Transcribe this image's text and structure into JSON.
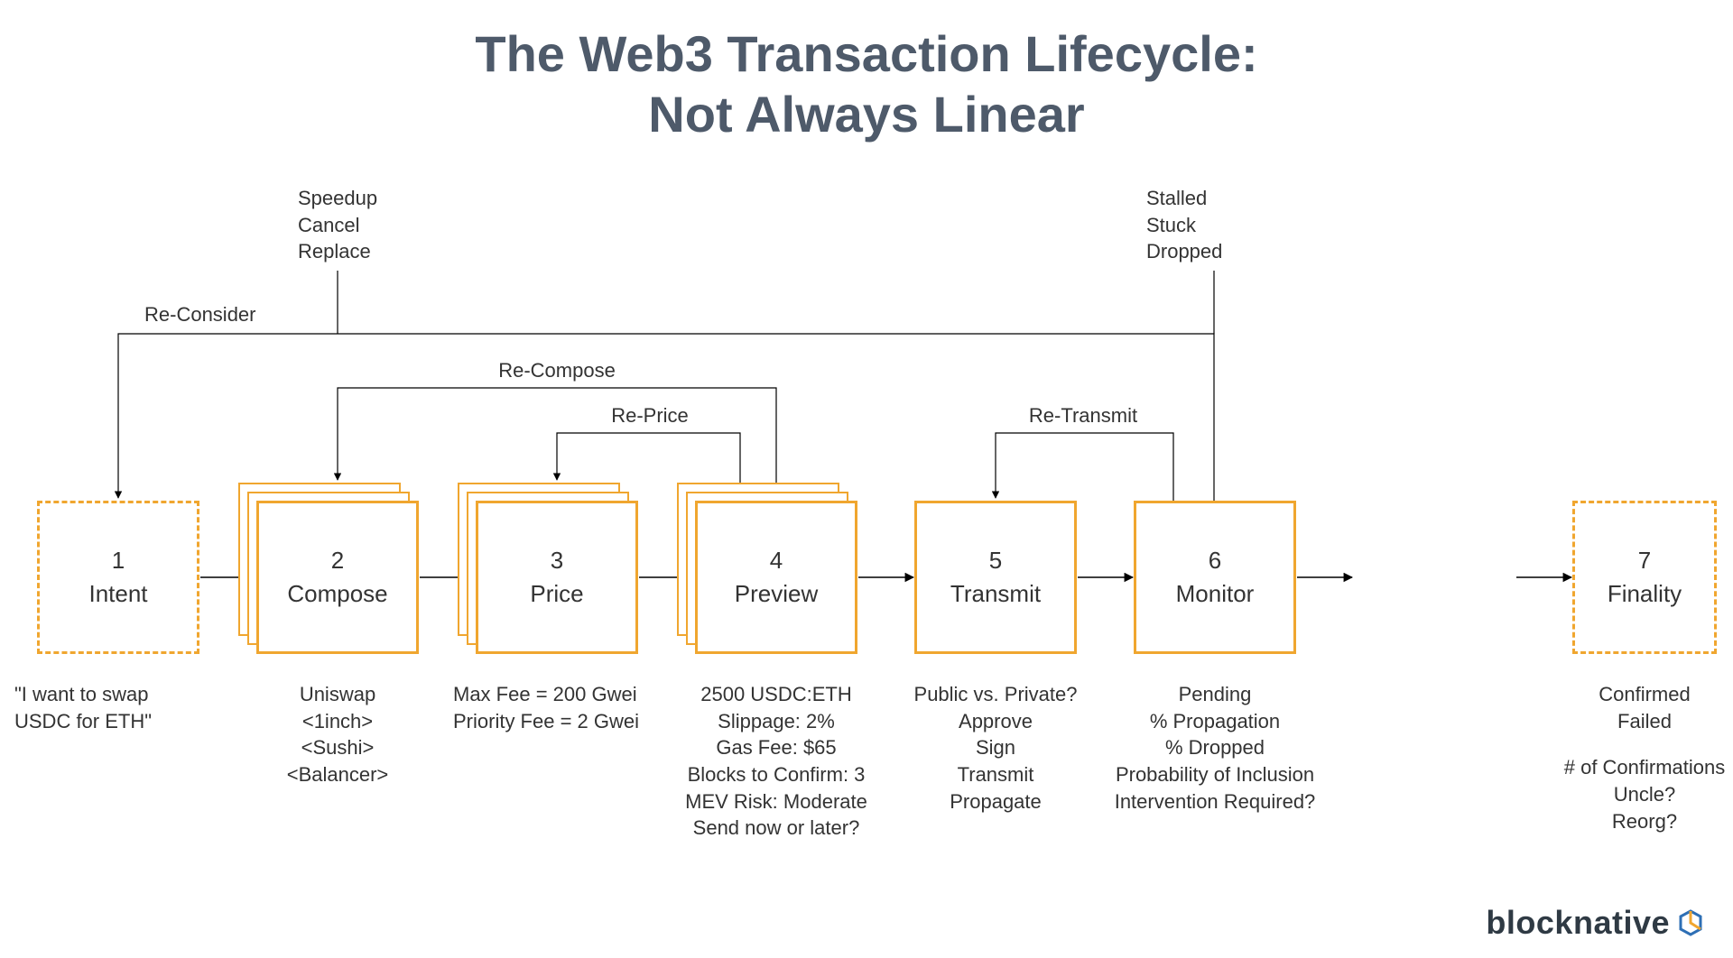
{
  "title_line1": "The Web3 Transaction Lifecycle:",
  "title_line2": "Not Always Linear",
  "colors": {
    "accent": "#f0a62f",
    "ink": "#3f4a56"
  },
  "stages": [
    {
      "num": "1",
      "name": "Intent",
      "style": "dashed",
      "notes": [
        "\"I want to swap",
        "USDC for ETH\""
      ]
    },
    {
      "num": "2",
      "name": "Compose",
      "style": "stack",
      "notes": [
        "Uniswap",
        "<1inch>",
        "<Sushi>",
        "<Balancer>"
      ]
    },
    {
      "num": "3",
      "name": "Price",
      "style": "stack",
      "notes": [
        "Max Fee = 200 Gwei",
        "Priority Fee = 2 Gwei"
      ]
    },
    {
      "num": "4",
      "name": "Preview",
      "style": "stack",
      "notes": [
        "2500 USDC:ETH",
        "Slippage: 2%",
        "Gas Fee: $65",
        "Blocks to Confirm: 3",
        "MEV Risk: Moderate",
        "Send now or later?"
      ]
    },
    {
      "num": "5",
      "name": "Transmit",
      "style": "solid",
      "notes": [
        "Public vs. Private?",
        "Approve",
        "Sign",
        "Transmit",
        "Propagate"
      ]
    },
    {
      "num": "6",
      "name": "Monitor",
      "style": "solid",
      "notes": [
        "Pending",
        "% Propagation",
        "% Dropped",
        "Probability of Inclusion",
        "Intervention Required?"
      ]
    },
    {
      "num": "7",
      "name": "Finality",
      "style": "dashed",
      "notes": [
        "Confirmed",
        "Failed",
        "",
        "# of Confirmations",
        "Uncle?",
        "Reorg?"
      ]
    }
  ],
  "feedback_labels": {
    "reconsider": "Re-Consider",
    "speedup": "Speedup\nCancel\nReplace",
    "recompose": "Re-Compose",
    "reprice": "Re-Price",
    "retransmit": "Re-Transmit",
    "stalled": "Stalled\nStuck\nDropped"
  },
  "logo_text": "blocknative"
}
